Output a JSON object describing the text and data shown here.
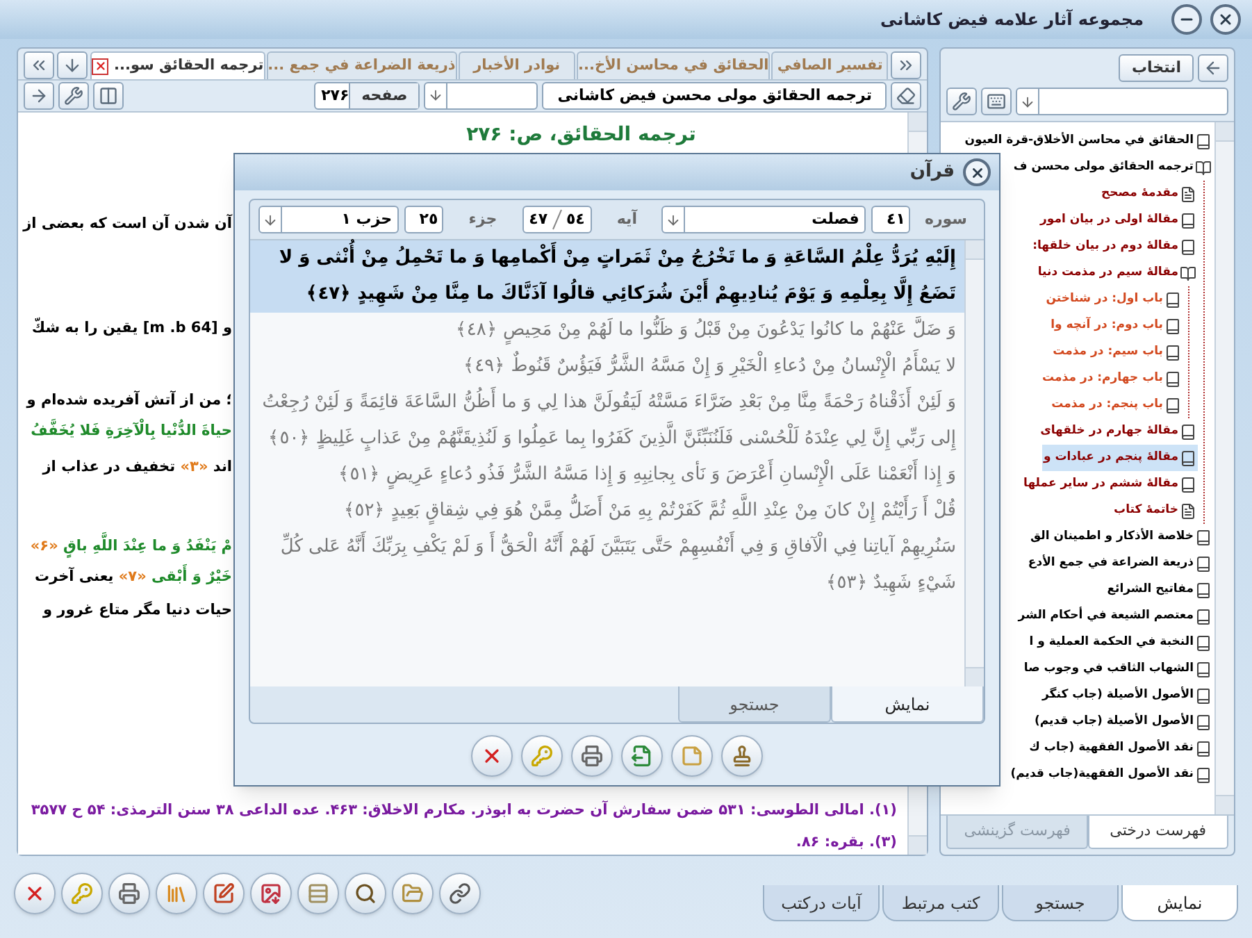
{
  "window": {
    "title": "مجموعه آثار علامه فيض كاشانى"
  },
  "book_tabs": [
    {
      "label": "تفسير الصافي",
      "selected": false
    },
    {
      "label": "الحقائق في محاسن الأخ...",
      "selected": false
    },
    {
      "label": "نوادر الأخبار",
      "selected": false
    },
    {
      "label": "ذريعة الضراعة في جمع ...",
      "selected": false
    },
    {
      "label": "ترجمه الحقائق سو...",
      "selected": true
    }
  ],
  "book_toolbar": {
    "book": "ترجمه الحقائق مولى محسن فيض كاشانى",
    "page_label": "صفحه",
    "page": "۲۷۶"
  },
  "content": {
    "heading": "ترجمه الحقائق، ص: ۲۷۶",
    "lines": [
      {
        "segments": [
          {
            "kind": "persian",
            "text": "آن شدن آن است كه بعضى از"
          }
        ]
      },
      {
        "segments": [
          {
            "kind": "persian",
            "text": "و [m .b 64] يقين را به شكّ"
          }
        ]
      },
      {
        "segments": [
          {
            "kind": "persian",
            "text": "؛ من از آتش آفريده شده‌ام و"
          }
        ]
      },
      {
        "segments": [
          {
            "kind": "arabic",
            "text": "حياةَ الدُّنْيا بِالْآخِرَةِ فَلا يُخَفَّفُ"
          }
        ]
      },
      {
        "segments": [
          {
            "kind": "persian",
            "text": "اند "
          },
          {
            "kind": "note",
            "text": "«۳»"
          },
          {
            "kind": "persian",
            "text": " تخفيف در عذاب از"
          }
        ]
      },
      {
        "segments": [
          {
            "kind": "arabic",
            "text": "مْ يَنْفَدُ وَ ما عِنْدَ اللَّهِ باقٍ"
          },
          {
            "kind": "note",
            "text": " «۶»"
          }
        ]
      },
      {
        "segments": [
          {
            "kind": "arabic",
            "text": "خَيْرٌ وَ أَبْقى"
          },
          {
            "kind": "note",
            "text": " «۷» "
          },
          {
            "kind": "persian",
            "text": "يعنى آخرت"
          }
        ]
      },
      {
        "segments": [
          {
            "kind": "persian",
            "text": "حيات دنيا مگر متاع غرور و"
          }
        ]
      }
    ],
    "footnotes": [
      "(۱). امالى الطوسى: ۵۳۱ ضمن سفارش آن حضرت به ابوذر. مكارم الاخلاق: ۴۶۳. عده الداعى ۳۸ سنن الترمذى: ۵۴ ح ۳۵۷۷",
      "(۳). بقره: ۸۶."
    ]
  },
  "quran": {
    "title": "قرآن",
    "surah_label": "سوره",
    "surah_number": "٤١",
    "surah_name": "فصلت",
    "ayah_label": "آيه",
    "ayah_total": "٥٤",
    "ayah": "٤٧",
    "juz_label": "جزء",
    "juz": "٢٥",
    "hizb": "حزب ١",
    "verses": [
      {
        "selected": true,
        "text": "إِلَيْهِ يُرَدُّ عِلْمُ السَّاعَةِ وَ ما تَخْرُجُ مِنْ ثَمَراتٍ مِنْ أَكْمامِها وَ ما تَحْمِلُ مِنْ أُنْثى وَ لا تَضَعُ إِلَّا بِعِلْمِهِ وَ يَوْمَ يُنادِيهِمْ أَيْنَ شُرَكائِي قالُوا آذَنَّاكَ ما مِنَّا مِنْ شَهِيدٍ ﴿٤٧﴾"
      },
      {
        "selected": false,
        "text": "وَ ضَلَّ عَنْهُمْ ما كانُوا يَدْعُونَ مِنْ قَبْلُ وَ ظَنُّوا ما لَهُمْ مِنْ مَحِيصٍ ﴿٤٨﴾"
      },
      {
        "selected": false,
        "text": "لا يَسْأَمُ الْإِنْسانُ مِنْ دُعاءِ الْخَيْرِ وَ إِنْ مَسَّهُ الشَّرُّ فَيَؤُسٌ قَنُوطٌ ﴿٤٩﴾"
      },
      {
        "selected": false,
        "text": "وَ لَئِنْ أَذَقْناهُ رَحْمَةً مِنَّا مِنْ بَعْدِ ضَرَّاءَ مَسَّتْهُ لَيَقُولَنَّ هذا لِي وَ ما أَظُنُّ السَّاعَةَ قائِمَةً وَ لَئِنْ رُجِعْتُ إِلى رَبِّي إِنَّ لِي عِنْدَهُ لَلْحُسْنى فَلَنُنَبِّئَنَّ الَّذِينَ كَفَرُوا بِما عَمِلُوا وَ لَنُذِيقَنَّهُمْ مِنْ عَذابٍ غَلِيظٍ ﴿٥٠﴾"
      },
      {
        "selected": false,
        "text": "وَ إِذا أَنْعَمْنا عَلَى الْإِنْسانِ أَعْرَضَ وَ نَأى بِجانِبِهِ وَ إِذا مَسَّهُ الشَّرُّ فَذُو دُعاءٍ عَرِيضٍ ﴿٥١﴾"
      },
      {
        "selected": false,
        "text": "قُلْ أَ رَأَيْتُمْ إِنْ كانَ مِنْ عِنْدِ اللَّهِ ثُمَّ كَفَرْتُمْ بِهِ مَنْ أَضَلُّ مِمَّنْ هُوَ فِي شِقاقٍ بَعِيدٍ ﴿٥٢﴾"
      },
      {
        "selected": false,
        "text": "سَنُرِيهِمْ آياتِنا فِي الْآفاقِ وَ فِي أَنْفُسِهِمْ حَتَّى يَتَبَيَّنَ لَهُمْ أَنَّهُ الْحَقُّ أَ وَ لَمْ يَكْفِ بِرَبِّكَ أَنَّهُ عَلى كُلِّ شَيْءٍ شَهِيدٌ ﴿٥٣﴾"
      }
    ],
    "tabs": [
      {
        "label": "نمايش",
        "selected": true
      },
      {
        "label": "جستجو",
        "selected": false
      }
    ]
  },
  "sidebar": {
    "button": "انتخاب",
    "tree": [
      {
        "label": "الحقائق في محاسن الأخلاق-قرة العيون",
        "kind": "book"
      },
      {
        "label": "ترجمه الحقائق مولى محسن ف",
        "kind": "book",
        "expanded": true,
        "selected": false,
        "children": [
          {
            "label": "مقدمهٔ مصحح",
            "kind": "page"
          },
          {
            "label": "مقالهٔ اولى در بيان امور",
            "kind": "book"
          },
          {
            "label": "مقالهٔ دوم در بيان خلقها:",
            "kind": "book"
          },
          {
            "label": "مقالهٔ سيم در مذمت دنيا",
            "kind": "book",
            "expanded": true,
            "children": [
              {
                "label": "باب اول: در شناختن",
                "kind": "book"
              },
              {
                "label": "باب دوم: در آنچه وا",
                "kind": "book"
              },
              {
                "label": "باب سيم: در مذمت",
                "kind": "book"
              },
              {
                "label": "باب جهارم: در مذمت",
                "kind": "book"
              },
              {
                "label": "باب پنجم: در مذمت",
                "kind": "book"
              }
            ]
          },
          {
            "label": "مقالهٔ جهارم در خلقهاى",
            "kind": "book"
          },
          {
            "label": "مقالهٔ پنجم در عبادات و",
            "kind": "book",
            "selected": true
          },
          {
            "label": "مقالهٔ ششم در ساير عملها",
            "kind": "book"
          },
          {
            "label": "خاتمهٔ كتاب",
            "kind": "page"
          }
        ]
      },
      {
        "label": "خلاصة الأذكار و اطمينان الق",
        "kind": "book"
      },
      {
        "label": "ذريعة الضراعة في جمع الأدع",
        "kind": "book"
      },
      {
        "label": "مفاتيح الشرائع",
        "kind": "book"
      },
      {
        "label": "معتصم الشيعة في أحكام الشر",
        "kind": "book"
      },
      {
        "label": "النخبة في الحكمة العملية و ا",
        "kind": "book"
      },
      {
        "label": "الشهاب الثاقب في وجوب صا",
        "kind": "book"
      },
      {
        "label": "الأصول الأصيلة (جاب كنگر",
        "kind": "book"
      },
      {
        "label": "الأصول الأصيلة (جاب قديم)",
        "kind": "book"
      },
      {
        "label": "نقد الأصول الفقهية (جاب ك",
        "kind": "book"
      },
      {
        "label": "نقد الأصول الفقهية(جاب قديم)",
        "kind": "book"
      }
    ],
    "tabs": [
      {
        "label": "فهرست درختى",
        "selected": true
      },
      {
        "label": "فهرست گزينشى",
        "selected": false
      }
    ]
  },
  "bottom_tabs": [
    {
      "label": "نمايش",
      "selected": true
    },
    {
      "label": "جستجو",
      "selected": false
    },
    {
      "label": "كتب مرتبط",
      "selected": false
    },
    {
      "label": "آيات دركتب",
      "selected": false
    }
  ]
}
